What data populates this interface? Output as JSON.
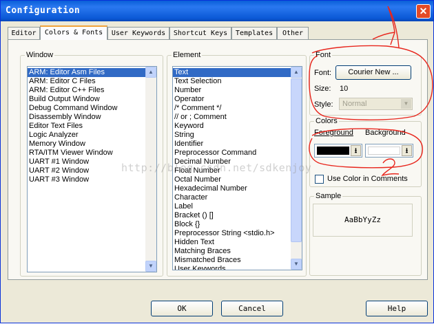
{
  "window": {
    "title": "Configuration",
    "close_label": "✕"
  },
  "tabs": [
    "Editor",
    "Colors & Fonts",
    "User Keywords",
    "Shortcut Keys",
    "Templates",
    "Other"
  ],
  "window_group": {
    "label": "Window",
    "items": [
      "ARM: Editor Asm Files",
      "ARM: Editor C Files",
      "ARM: Editor C++ Files",
      "Build Output Window",
      "Debug Command Window",
      "Disassembly Window",
      "Editor Text Files",
      "Logic Analyzer",
      "Memory Window",
      "RTA/ITM Viewer Window",
      "UART #1 Window",
      "UART #2 Window",
      "UART #3 Window"
    ]
  },
  "element_group": {
    "label": "Element",
    "items": [
      "Text",
      "Text Selection",
      "Number",
      "Operator",
      "/* Comment */",
      "// or ; Comment",
      "Keyword",
      "String",
      "Identifier",
      "Preprocessor Command",
      "Decimal Number",
      "Float Number",
      "Octal Number",
      "Hexadecimal Number",
      "Character",
      "Label",
      "Bracket () []",
      "Block {}",
      "Preprocessor String <stdio.h>",
      "Hidden Text",
      "Matching Braces",
      "Mismatched Braces",
      "User Keywords"
    ]
  },
  "font_group": {
    "label": "Font",
    "font_label": "Font:",
    "font_button": "Courier New ...",
    "size_label": "Size:",
    "size_value": "10",
    "style_label": "Style:",
    "style_value": "Normal"
  },
  "colors_group": {
    "label": "Colors",
    "foreground_label": "Foreground",
    "background_label": "Background",
    "foreground_color": "#000000",
    "background_color": "#ffffff",
    "use_color_label": "Use Color in Comments"
  },
  "sample_group": {
    "label": "Sample",
    "text": "AaBbYyZz"
  },
  "buttons": {
    "ok": "OK",
    "cancel": "Cancel",
    "help": "Help"
  },
  "watermark": "http://blog.csdn.net/sdkenjoy",
  "annotation_color": "#e8251c"
}
